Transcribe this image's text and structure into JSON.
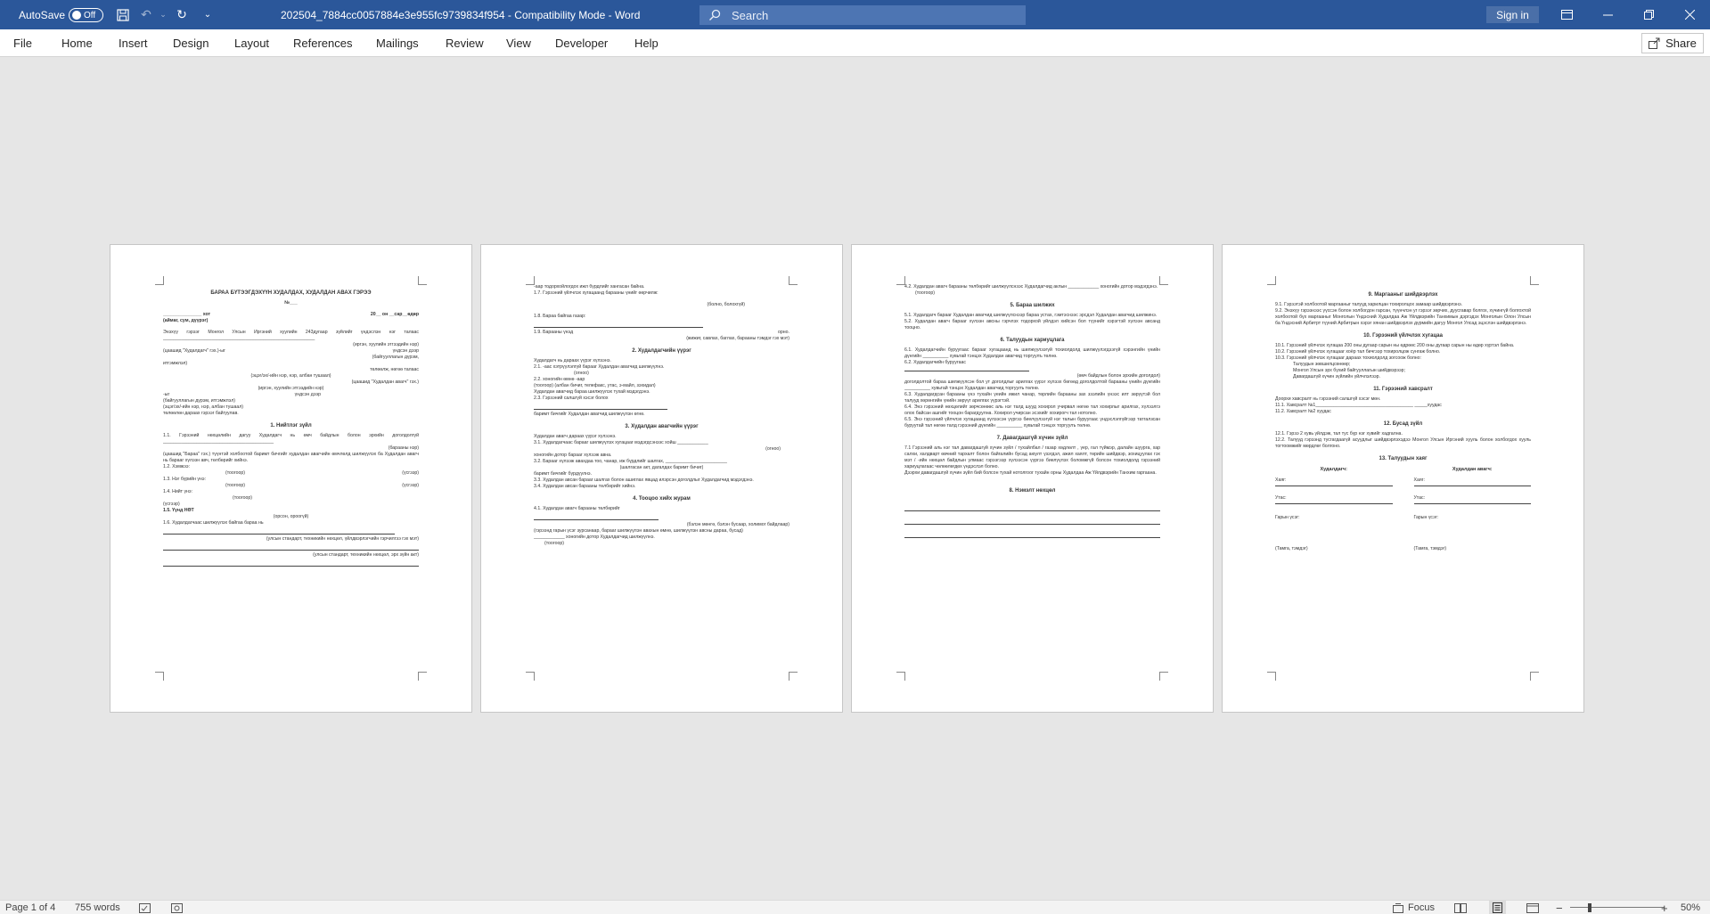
{
  "titlebar": {
    "autosave_label": "AutoSave",
    "autosave_state": "Off",
    "doc_title": "202504_7884cc0057884e3e955fc9739834f954  -  Compatibility Mode  -  Word",
    "search_placeholder": "Search",
    "signin_label": "Sign in"
  },
  "ribbon": {
    "tabs": [
      "File",
      "Home",
      "Insert",
      "Design",
      "Layout",
      "References",
      "Mailings",
      "Review",
      "View",
      "Developer",
      "Help"
    ],
    "share_label": "Share"
  },
  "pages": {
    "p1": {
      "title": "БАРАА БҮТЭЭГДЭХҮҮН ХУДАЛДАХ, ХУДАЛДАН АВАХ ГЭРЭЭ",
      "number": "№___",
      "city_line": "_______________ хот",
      "date_line": "20__ он __сар__өдөр",
      "region_line": "(аймаг, сум, дүүрэг)",
      "intro": "Энэхүү гэрээг Монгол Улсын Иргэний хуулийн 243дугаар зүйлийг үндэслэн нэг талаас ___________________________________________________________",
      "l1": "(иргэн, хуулийн этгээдийн нэр)",
      "l2": "(цаашид \"Худалдагч\" гэх.)-ыг",
      "l3": "үндсэн дээр",
      "l4": "(байгууллагын дүрэм,",
      "l5": "итгэмжлэл)",
      "l6": "төлөөлж, нөгөө талаас",
      "l7": "(эцэг/эх/-ийн нэр, нэр, албан тушаал)",
      "l8": "(цаашид \"Худалдан авагч\" гэх.)",
      "l9": "(иргэн, хуулийн этгээдийн нэр)",
      "l10": "-ыг",
      "l11": "үндсэн дээр",
      "l12": "(байгууллагын дүрэм, итгэмжлэл)",
      "l13": "(эцэг/эх/-ийн нэр, нэр, албан тушаал)",
      "l14": "төлөөлөн дараах гэрээг байгуулав.",
      "s1": "1. Нийтлэг зүйл",
      "s1_1": "1.1. Гэрээний нөхцөлийн дагуу Худалдагч нь өмч байдлын болон эрхийн доголдолгүй ___________________________________________",
      "s1_1b": "(барааны нэр)",
      "s1_1c": "(цаашид \"Бараа\" гэх.) түүнтэй холбоотой баримт бичгийг худалдан авагчийн өмчлөлд шилжүүлэх ба Худалдан авагч нь барааг хүлээн авч, төлбөрийг хийнэ.",
      "s1_2": "1.2. Хэмжээ:",
      "tsoogoor": "(тоогоор)",
      "useg": "(үсгээр)",
      "s1_3": "1.3. Нэг бүрийн үнэ:",
      "s1_4": "1.4. Нийт үнэ:",
      "s1_5": "1.5. Үүнд НӨТ",
      "s1_5b": "(орсон, ороогүй)",
      "s1_6": "1.6. Худалдагчаас шилжүүлэх байгаа бараа нь",
      "s1_6b": "(улсын стандарт, техникийн нөхцөл, үйлдвэрлэгчийн гэрчилгээ гэх мэт)",
      "s1_6c": "(улсын стандарт, техникийн нөхцөл, эрх зүйн акт)"
    },
    "p2": {
      "a1": "-аар тодорхойлогдох ижл бүрдлийг хангасан байна.",
      "a2": "1.7. Гэрээний үйлчлэх хугацаанд барааны үнийг өөрчилж:",
      "a3": "(болно, болохгүй)",
      "a4": "1.8. Бараа байгаа газар:",
      "a5": "1.9. Барааны үнэд",
      "a6": "орно.",
      "a7": "(жижиг, савлах, баглах, барааны тэмдэг гэх мэт)",
      "s2": "2. Худалдагчийн үүрэг",
      "b1": "Худалдагч нь дараах үүрэг хүлээнэ.",
      "b2": "2.1.                    -ааc хэтрүүлэлгүй барааг Худалдан авагчид шилжүүлнэ.",
      "b3": "(огноо)",
      "b4": "2.2.                    хоногийн өмнө                               -аар",
      "b5": "(тоогоор)                                            (албан бичиг, телефакс, утас, э-майл, зэхидал)",
      "b6": "Худалдан авагчид бараа шилжүүлэх тухай мэдэгдэнэ.",
      "b7": "2.3. Гэрээний салшгүй хэсэг болох",
      "b8": "баримт бичгийг Худалдан авагчид шилжүүлэн өгнө.",
      "s3": "3. Худалдан авагчийн үүрэг",
      "c1": "Худалдан авагч дараах үүрэг хүлээнэ.",
      "c2": "3.1. Худалдагчаас барааг шилжүүлэх хугацааг мэдэгдсэнээс хойш ____________",
      "c3": "хоногийн дотор барааг хүлээж авна.",
      "c4": "3.2. Барааг хүлээж авахдаа тоо, чанар, иж бүрдлийг шалгах, ________________________",
      "c5": "(шалгасан акт, дагалдах баримт бичиг)",
      "c6": "баримт бичгийг бүрдүүлнэ.",
      "c7": "3.3. Худалдан авсан барааг шалгах болон ашиглах явцад илэрсэн доголдлыг Худалдагчид мэдэгдэнэ.",
      "c8": "3.4. Худалдан авсан барааны төлбөрийг хийнэ.",
      "s4": "4. Тооцоо хийх журам",
      "d1": "4.1. Худалдан авагч барааны төлбөрийг",
      "d2": "(бэлэн мөнгө, бэлэн бусаар, холимог байдлаар)",
      "d3": "(гэрээнд гарын үсэг зурсанаар, барааг шилжүүлэн авахын өмнө, шилжүүлэн авсны дараа, бусад)",
      "d4": "____________ хоногийн дотор Худалдагчид шилжүүлнэ.",
      "d5": "(тоогоор)"
    },
    "p3": {
      "e1": "4.2. Худалдан авагч барааны төлбөрийг шилжүүлснээс Худалдагчид аклын ____________ хоногийн дотор мэдэгдэнэ.",
      "e2": "(тоогоор)",
      "s5": "5. Бараа шилжих",
      "f1": "5.1. Худалдагч барааг Худалдан авагчид шилжүүлснээр бараа устах, гэмтэснээс эрсдэл Худалдан авагчид шилжинэ.",
      "f2": "5.2. Худалдан авагч барааг хүлээн авсны гэрчлэх тодорхой үйлдэл хийсэн бол түүнийг хэрэгтэй хүлээн авсанд тооцно.",
      "s6": "6. Талуудын хариуцлага",
      "g1": "6.1. Худалдагчийн буруугаас барааг хугацаанд нь шилжүүлээгүй тохиолдолд шилжүүлэгдээгүй хэрэнгийн үнийн дүнгийн __________ хувьтай тэнцэх Худалдан авагчид торгуулъ төлнө.",
      "g2": "6.2. Худалдагчийн буруугаас",
      "g3": "(өмч байдлын болон эрхийн доголдол)",
      "g4": "доголдолтой бараа шилжүүлсэн бол ут доголдлыг арилгах үүрэг хүлээх бөгөөд доголдолтой барааны үнийн дүнгийн __________ хувьтай тэнцэх Худалдан авагчид торгуулъ төлнө.",
      "g5": "6.3. Худалдагдсан барааны үнэ тухайн үеийн ижил чанар, төрлийн барааны зах зээлийн үнээс илт зөрүүтэй бол талууд хөрөнгийн үнийн зөрүүг арилгах үүрэгтэй.",
      "g6": "6.4. Энэ гэрээний нөхцөлийг зөрчсөнөөс аль нэг талд шууд хохирол учирвал нөгөө тал хохирлыг арилгах, хүлээлгэ олох байсан ашгийг тооцон барагдуулна. Хохирол учирсан эсэхийг хохирогч тал нотолно.",
      "g7": "6.5. Энэ гэрээний үйлчлэх хугацаанд хүлээсэн үүргээ биелүүлээгүй нэг талын буруугаас үндэслэлгүйгээр татгалзсан буруутай тал нөгөө талд гэрээний дүнгийн __________ хувьтай тэнцэх торгуулъ төлнө.",
      "s7": "7. Давагдашгүй хүчин зүйл",
      "h1": "7.1 Гэрээний аль нэг тал давагдашгүй хүчин зүйл / тухайлбал / газар хөдлөлт , үер, гал түймэр, далайн шуурга, хар салхи, халдварт өвчний тархалт болон байгалийн бусад аюулт үзэгдэл, ажил хаялт, төрийн шийдвэр, зохицуулах гэх мэт / -ийн нөхцөл байдлын улмаас гэрээгээр хүлээсэн үүргээ биелүүлэх боломжгүй болсон тохиолдолд гэрээний хариуцлагаас чөлөөлөгдөх үндэслэл болно.",
      "h2": "Дээрхи давагдашгүй хүчин зүйл бий болсон тухай нотолгоог тухайн орны Худалдаа Аж Үйлдвэрийн Танхим гаргаана.",
      "s8": "8. Нэмэлт нөхцөл"
    },
    "p4": {
      "s9": "9. Маргааныг шийдвэрлэх",
      "i1": "9.1. Гэрээтэй холбоотой маргааныг талууд харилцан тохиролцох замаар шийдвэрлэнэ.",
      "i2": "9.2. Энэхүү гэрээнээс үүссэн болон холбогдон гарсан, түүнчлэн уг гэрээг зөрчих, дуусгавар болгох, хүчингүй болгохтой холбоотой бүх маргааныг Монголын Үндэсний Худалдаа Аж Үйлдвэрийн Танхимын дэргэдэх Монголын Олон Улсын ба Үндэсний Арбитрт түүний Арбитрын хэрэг хянан шийдвэрлэх дүрмийн дагуу Монгол Улсад эцэслэн шийдвэрлэнэ.",
      "s10": "10. Гэрээний үйлчлэх хугацаа",
      "j1": "10.1. Гэрээний үйлчлэх хугацаа 200     оны     дугаар сарын     ны өдрөөс 200 оны     дугаар сарын     ны өдөр хүртэл байна.",
      "j2": "10.2. Гэрээний үйлчлэх хугацааг хоёр тал бичгээр тохиролцож сунгаж болно.",
      "j3": "10.3. Гэрээний үйлчлэх хугацааг дараах тохиолдолд зогсоож болно:",
      "j4": "Талуудын зөвшилцсөнөөр;",
      "j5": "Монгол Улсын эрх бүхий байгууллагын шийдвэрээр;",
      "j6": "Давагдашгүй хүчин зүйлийн үйлчлэлээр.",
      "s11": "11. Гэрээний хавсралт",
      "k1": "Доорхи хавсралт нь гэрээний салшгүй хэсэг мөн.",
      "k2": "11.1. Хавсралт №1______________________________________ _____хуудас",
      "k3": "11.2. Хавсралт №2                                                                          хуудас",
      "s12": "12. Бусад зүйл",
      "m1": "12.1. Гэрээ 2 хувь үйлдэж, тал тус бүр нэг хувийг хадгална.",
      "m2": "12.2. Талууд гэрээнд тусгагдаагүй асуудлыг шийдвэрлэхэдээ Монгол Улсын Иргэний хууль болон холбогдох хууль тогтоомжийг мөрдлөг болгоно.",
      "s13": "13. Талуудын хаяг",
      "seller": "Худалдагч:",
      "buyer": "Худалдан авагч:",
      "addr": "Хаяг:",
      "phone": "Утас:",
      "sign": "Гарын үсэг:",
      "stamp": "(Тамга, тэмдэг)"
    }
  },
  "status": {
    "page": "Page 1 of 4",
    "words": "755 words",
    "focus": "Focus",
    "zoom": "50%"
  }
}
